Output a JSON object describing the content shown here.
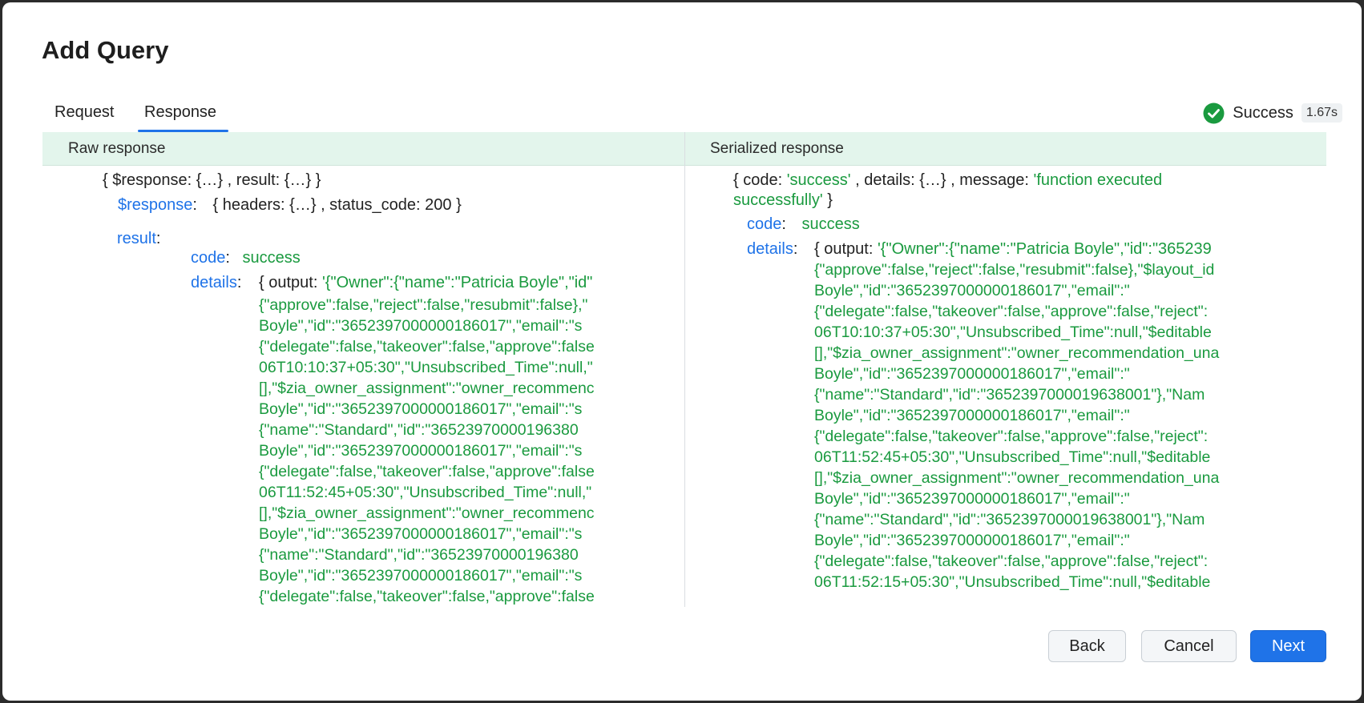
{
  "dialog": {
    "title": "Add Query"
  },
  "tabs": [
    {
      "label": "Request",
      "active": false
    },
    {
      "label": "Response",
      "active": true
    }
  ],
  "status": {
    "label": "Success",
    "time": "1.67s",
    "icon": "check-circle-icon",
    "color": "#1a9a3f"
  },
  "raw": {
    "header": "Raw response",
    "summary": "{ $response: {…} , result: {…} }",
    "response_key": "$response",
    "response_value": "{ headers: {…} , status_code: 200 }",
    "result_key": "result",
    "code_key": "code",
    "code_value": "success",
    "details_key": "details",
    "output_prefix": "{ output: ",
    "output_first": "'{\"Owner\":{\"name\":\"Patricia Boyle\",\"id\"",
    "output_lines": [
      "{\"approve\":false,\"reject\":false,\"resubmit\":false},\"",
      "Boyle\",\"id\":\"3652397000000186017\",\"email\":\"s",
      "{\"delegate\":false,\"takeover\":false,\"approve\":false",
      "06T10:10:37+05:30\",\"Unsubscribed_Time\":null,\"",
      "[],\"$zia_owner_assignment\":\"owner_recommenc",
      "Boyle\",\"id\":\"3652397000000186017\",\"email\":\"s",
      "{\"name\":\"Standard\",\"id\":\"36523970000196380",
      "Boyle\",\"id\":\"3652397000000186017\",\"email\":\"s",
      "{\"delegate\":false,\"takeover\":false,\"approve\":false",
      "06T11:52:45+05:30\",\"Unsubscribed_Time\":null,\"",
      "[],\"$zia_owner_assignment\":\"owner_recommenc",
      "Boyle\",\"id\":\"3652397000000186017\",\"email\":\"s",
      "{\"name\":\"Standard\",\"id\":\"36523970000196380",
      "Boyle\",\"id\":\"3652397000000186017\",\"email\":\"s",
      "{\"delegate\":false,\"takeover\":false,\"approve\":false"
    ]
  },
  "serialized": {
    "header": "Serialized response",
    "summary_open": "{ code: ",
    "summary_code": "'success'",
    "summary_mid": " , details: {…} , message: ",
    "summary_msg1": "'function executed",
    "summary_msg2": "successfully'",
    "summary_close": " }",
    "code_key": "code",
    "code_value": "success",
    "details_key": "details",
    "output_prefix": "{ output: ",
    "output_first": "'{\"Owner\":{\"name\":\"Patricia Boyle\",\"id\":\"365239",
    "output_lines": [
      "{\"approve\":false,\"reject\":false,\"resubmit\":false},\"$layout_id",
      "Boyle\",\"id\":\"3652397000000186017\",\"email\":\"",
      "{\"delegate\":false,\"takeover\":false,\"approve\":false,\"reject\":",
      "06T10:10:37+05:30\",\"Unsubscribed_Time\":null,\"$editable",
      "[],\"$zia_owner_assignment\":\"owner_recommendation_una",
      "Boyle\",\"id\":\"3652397000000186017\",\"email\":\"",
      "{\"name\":\"Standard\",\"id\":\"3652397000019638001\"},\"Nam",
      "Boyle\",\"id\":\"3652397000000186017\",\"email\":\"",
      "{\"delegate\":false,\"takeover\":false,\"approve\":false,\"reject\":",
      "06T11:52:45+05:30\",\"Unsubscribed_Time\":null,\"$editable",
      "[],\"$zia_owner_assignment\":\"owner_recommendation_una",
      "Boyle\",\"id\":\"3652397000000186017\",\"email\":\"",
      "{\"name\":\"Standard\",\"id\":\"3652397000019638001\"},\"Nam",
      "Boyle\",\"id\":\"3652397000000186017\",\"email\":\"",
      "{\"delegate\":false,\"takeover\":false,\"approve\":false,\"reject\":",
      "06T11:52:15+05:30\",\"Unsubscribed_Time\":null,\"$editable"
    ]
  },
  "buttons": {
    "back": "Back",
    "cancel": "Cancel",
    "next": "Next"
  }
}
